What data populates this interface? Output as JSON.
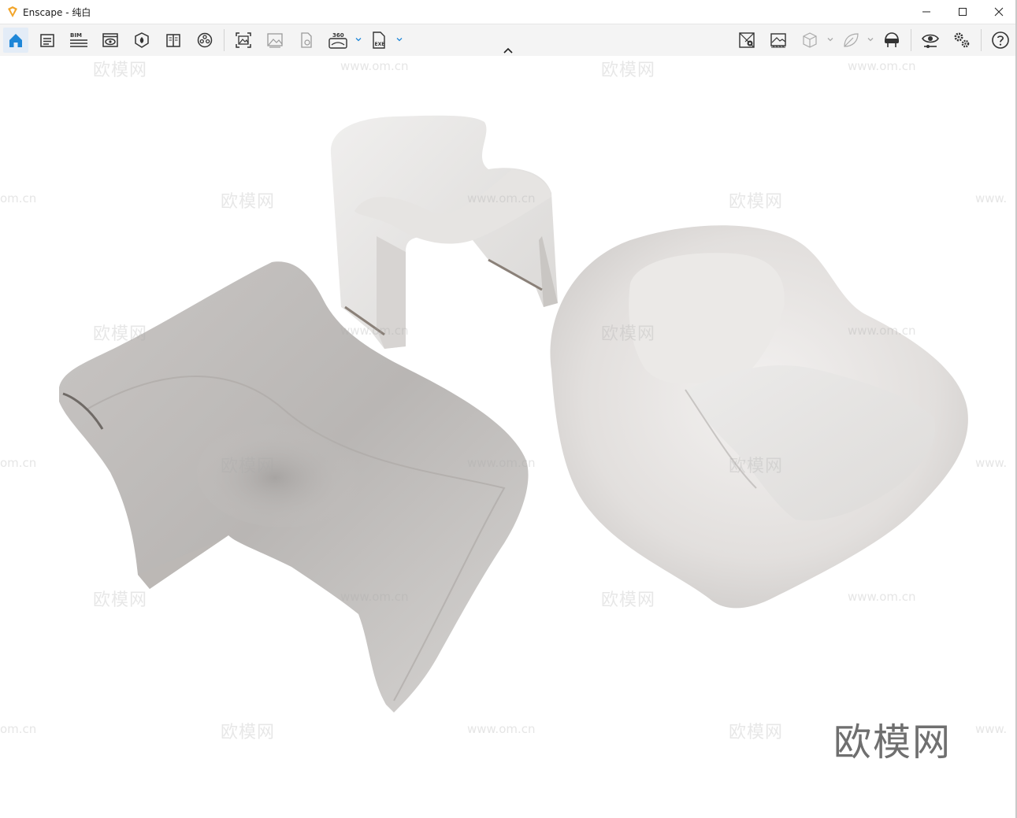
{
  "window": {
    "title": "Enscape - 纯白",
    "controls": [
      "minimize",
      "maximize",
      "close"
    ]
  },
  "toolbar": {
    "left_icons": [
      "home-icon",
      "project-info-icon",
      "bim-icon",
      "views-icon",
      "materials-icon",
      "library-icon",
      "asset-library-icon",
      "screenshot-icon",
      "batch-render-icon",
      "panorama-icon",
      "360-export-icon",
      "exe-export-icon"
    ],
    "bim_label": "BIM",
    "pano_label": "360",
    "exe_label": "EXE",
    "right_icons": [
      "map-icon",
      "atmosphere-icon",
      "cube-icon",
      "leaf-icon",
      "vr-headset-icon",
      "visual-settings-icon",
      "settings-icon",
      "help-icon"
    ]
  },
  "viewport": {
    "description_objects": [
      "lounge-chair-left",
      "stool-chair-back",
      "armchair-right"
    ],
    "watermark_text": "欧模网",
    "watermark_url": "www.om.cn",
    "watermark_url_partial_left": "om.cn",
    "watermark_url_partial_right": "www.",
    "brand_watermark": "欧模网"
  }
}
